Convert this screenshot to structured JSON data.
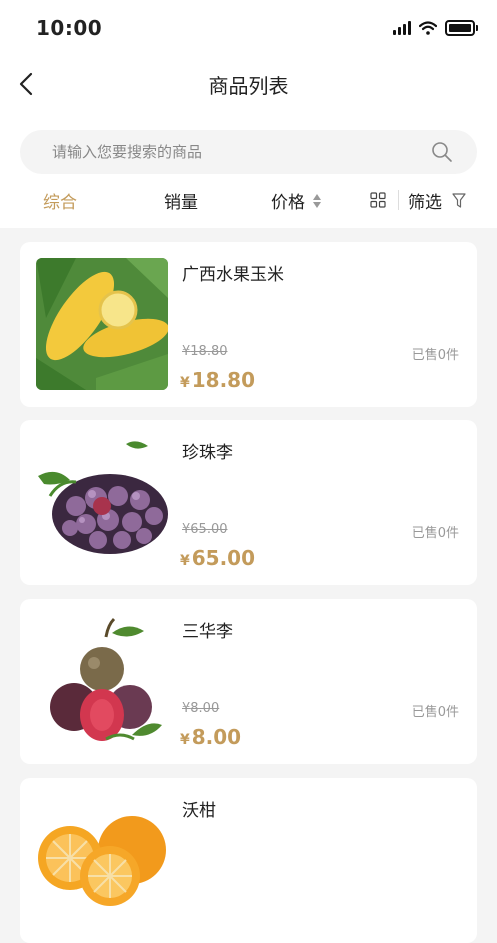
{
  "status_bar": {
    "time": "10:00"
  },
  "navbar": {
    "title": "商品列表"
  },
  "search": {
    "placeholder": "请输入您要搜索的商品",
    "value": ""
  },
  "sort": {
    "comprehensive": "综合",
    "sales": "销量",
    "price": "价格",
    "filter": "筛选"
  },
  "colors": {
    "accent": "#c39b5b",
    "background": "#f4f4f4",
    "card": "#ffffff",
    "muted": "#999999"
  },
  "products": [
    {
      "name": "广西水果玉米",
      "currency": "¥",
      "original_price": "18.80",
      "price": "18.80",
      "sold": "已售0件",
      "image": "corn-image"
    },
    {
      "name": "珍珠李",
      "currency": "¥",
      "original_price": "65.00",
      "price": "65.00",
      "sold": "已售0件",
      "image": "purple-plum-image"
    },
    {
      "name": "三华李",
      "currency": "¥",
      "original_price": "8.00",
      "price": "8.00",
      "sold": "已售0件",
      "image": "red-plum-image"
    },
    {
      "name": "沃柑",
      "currency": "¥",
      "original_price": "",
      "price": "",
      "sold": "",
      "image": "mandarin-orange-image"
    }
  ]
}
